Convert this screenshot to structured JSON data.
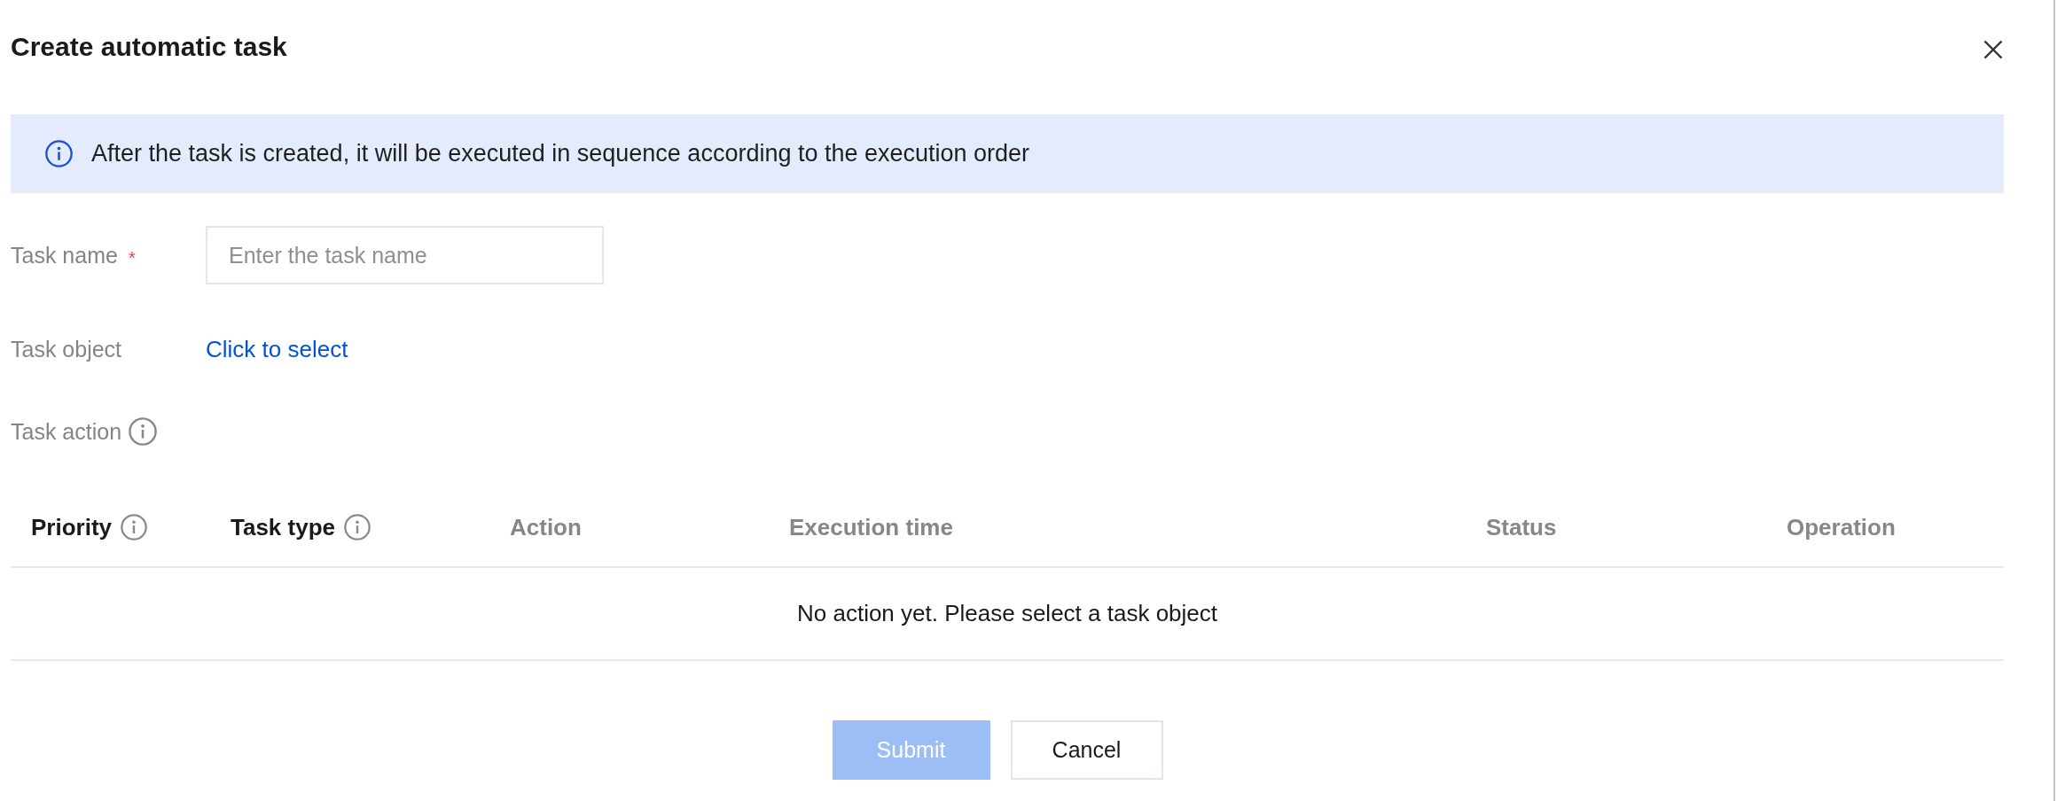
{
  "dialog": {
    "title": "Create automatic task",
    "closable": true
  },
  "notice": {
    "text": "After the task is created, it will be executed in sequence according to the execution order"
  },
  "form": [
    {
      "kind": "input",
      "label": "Task name",
      "required_mark": "*",
      "placeholder": "Enter the task name",
      "has_info": false
    },
    {
      "kind": "link",
      "label": "Task object",
      "link": "Click to select",
      "has_info": false
    },
    {
      "kind": "section",
      "label": "Task action",
      "has_info": true
    }
  ],
  "table": {
    "columns": [
      {
        "label": "Priority",
        "disabled": false,
        "has_info": true
      },
      {
        "label": "Task type",
        "disabled": false,
        "has_info": true
      },
      {
        "label": "Action",
        "disabled": true,
        "has_info": false
      },
      {
        "label": "Execution time",
        "disabled": true,
        "has_info": false
      },
      {
        "label": "Status",
        "disabled": true,
        "has_info": false
      },
      {
        "label": "Operation",
        "disabled": true,
        "has_info": false
      }
    ],
    "empty_text": "No action yet. Please select a task object"
  },
  "buttons": [
    {
      "label": "Submit",
      "kind": "primary",
      "disabled": true
    },
    {
      "label": "Cancel",
      "kind": "secondary",
      "disabled": false
    }
  ]
}
